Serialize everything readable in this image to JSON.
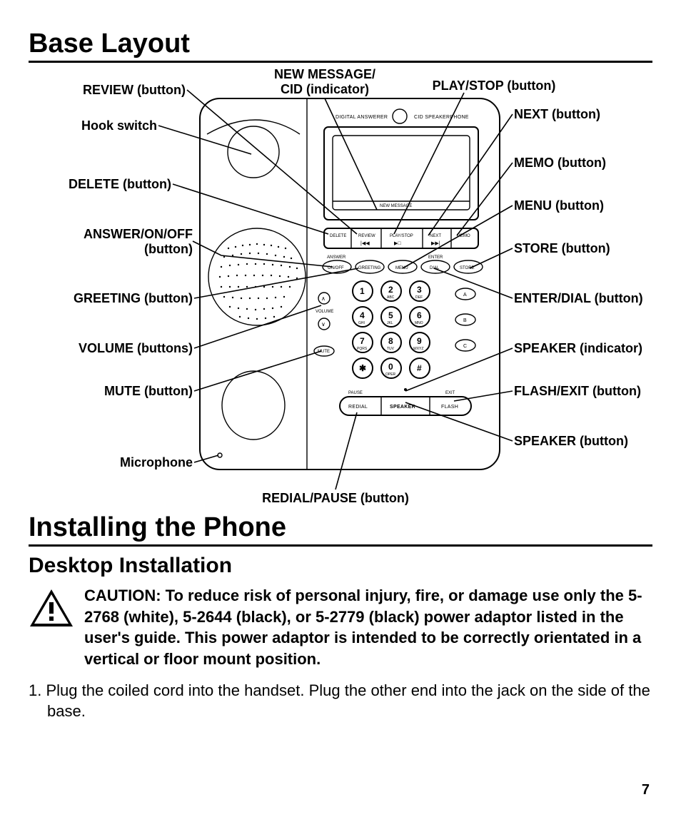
{
  "headings": {
    "base_layout": "Base Layout",
    "installing": "Installing the Phone",
    "desktop": "Desktop Installation"
  },
  "callouts": {
    "review": "REVIEW (button)",
    "new_message_line1": "NEW MESSAGE/",
    "new_message_line2": "CID (indicator)",
    "play_stop": "PLAY/STOP (button)",
    "next": "NEXT (button)",
    "hook_switch": "Hook switch",
    "memo": "MEMO (button)",
    "delete": "DELETE (button)",
    "menu": "MENU (button)",
    "answer_on_off_line1": "ANSWER/ON/OFF",
    "answer_on_off_line2": "(button)",
    "store": "STORE (button)",
    "greeting": "GREETING (button)",
    "enter_dial": "ENTER/DIAL (button)",
    "volume": "VOLUME (buttons)",
    "speaker_indicator": "SPEAKER (indicator)",
    "mute": "MUTE (button)",
    "flash_exit": "FLASH/EXIT (button)",
    "microphone": "Microphone",
    "speaker_button": "SPEAKER (button)",
    "redial_pause": "REDIAL/PAUSE (button)"
  },
  "phone_labels": {
    "digital_answerer": "DIGITAL ANSWERER",
    "cid_speakerphone": "CID SPEAKERPHONE",
    "new_message": "NEW MESSAGE",
    "delete": "DELETE",
    "review": "REVIEW",
    "play_stop": "PLAY/STOP",
    "next": "NEXT",
    "memo": "MEMO",
    "answer": "ANSWER",
    "on_off": "ON/OFF",
    "greeting": "GREETING",
    "menu": "MENU",
    "enter": "ENTER",
    "dial": "DIAL",
    "store": "STORE",
    "volume": "VOLUME",
    "mute": "MUTE",
    "pause": "PAUSE",
    "redial": "REDIAL",
    "speaker": "SPEAKER",
    "exit": "EXIT",
    "flash": "FLASH",
    "a": "A",
    "b": "B",
    "c": "C",
    "k1": "1",
    "k2": "2",
    "k2s": "ABC",
    "k3": "3",
    "k3s": "DEF",
    "k4": "4",
    "k4s": "GHI",
    "k5": "5",
    "k5s": "JKL",
    "k6": "6",
    "k6s": "MNO",
    "k7": "7",
    "k7s": "PQRS",
    "k8": "8",
    "k8s": "TUV",
    "k9": "9",
    "k9s": "WXYZ",
    "kstar": "✱",
    "k0": "0",
    "k0s": "OPER",
    "khash": "#"
  },
  "caution": "CAUTION: To reduce risk of personal injury, fire, or damage use only the 5-2768 (white), 5-2644 (black), or 5-2779 (black) power adaptor listed in the user's guide. This power adaptor is intended to be correctly orientated in a vertical or floor mount position.",
  "step1_prefix": "1. ",
  "step1": "Plug the coiled cord into the handset. Plug the other end into the jack on the side of the base.",
  "page": "7"
}
